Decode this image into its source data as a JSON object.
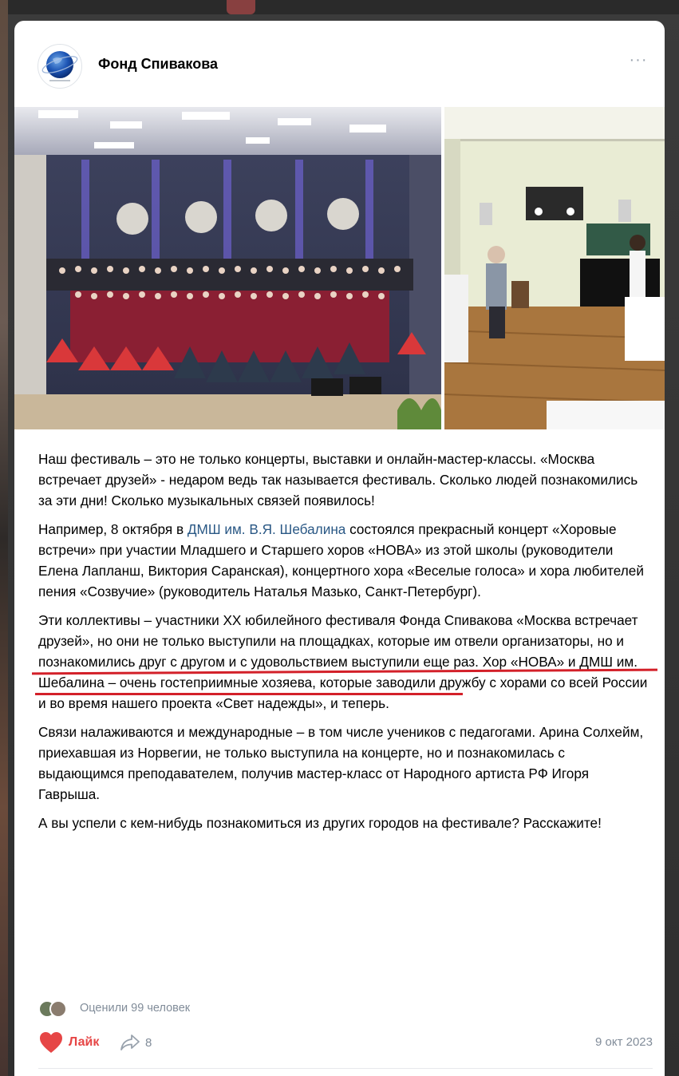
{
  "post": {
    "author": "Фонд Спивакова",
    "more_icon": "more-horizontal-icon",
    "paragraphs": {
      "p1": "Наш фестиваль – это не только концерты, выставки и онлайн-мастер-классы. «Москва встречает друзей» - недаром ведь так называется фестиваль. Сколько людей познакомились за эти дни! Сколько музыкальных связей появилось!",
      "p2_before": "Например, 8 октября в ",
      "p2_link": "ДМШ им. В.Я. Шебалина",
      "p2_after": " состоялся прекрасный концерт «Хоровые встречи» при участии Младшего и Старшего хоров «НОВА» из этой школы (руководители Елена Лапланш, Виктория Саранская), концертного хора «Веселые голоса» и хора любителей пения «Созвучие» (руководитель Наталья Мазько, Санкт-Петербург).",
      "p3": "Эти коллективы – участники XX юбилейного фестиваля Фонда Спивакова «Москва встречает друзей», но они не только выступили на площадках, которые им отвели организаторы, но и познакомились друг с другом и с удовольствием выступили еще раз. Хор «НОВА» и ДМШ им. Шебалина – очень гостеприимные хозяева, которые заводили дружбу с хорами со всей России и во время нашего проекта «Свет надежды», и теперь.",
      "p4": "Связи налаживаются и международные – в том числе учеников с педагогами. Арина Солхейм, приехавшая из Норвегии, не только выступила на концерте, но и познакомилась с выдающимся преподавателем, получив мастер-класс от Народного артиста РФ Игоря Гаврыша.",
      "p5": "А вы успели с кем-нибудь познакомиться из других городов на фестивале? Расскажите!"
    },
    "likes_text": "Оценили 99 человек",
    "like_label": "Лайк",
    "share_count": "8",
    "date": "9 окт 2023"
  },
  "colors": {
    "link": "#2a5885",
    "like": "#e64646",
    "muted": "#818c99",
    "underline": "#d32029"
  }
}
